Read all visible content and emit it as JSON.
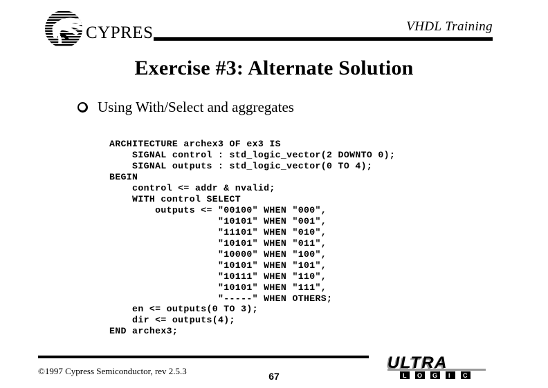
{
  "header": {
    "logo_name": "cypress-logo",
    "title": "VHDL Training"
  },
  "slide": {
    "title": "Exercise #3: Alternate Solution",
    "bullet": {
      "marker": "hollow-circle",
      "text": "Using With/Select and aggregates"
    },
    "code": "ARCHITECTURE archex3 OF ex3 IS\n    SIGNAL control : std_logic_vector(2 DOWNTO 0);\n    SIGNAL outputs : std_logic_vector(0 TO 4);\nBEGIN\n    control <= addr & nvalid;\n    WITH control SELECT\n        outputs <= \"00100\" WHEN \"000\",\n                   \"10101\" WHEN \"001\",\n                   \"11101\" WHEN \"010\",\n                   \"10101\" WHEN \"011\",\n                   \"10000\" WHEN \"100\",\n                   \"10101\" WHEN \"101\",\n                   \"10111\" WHEN \"110\",\n                   \"10101\" WHEN \"111\",\n                   \"-----\" WHEN OTHERS;\n    en <= outputs(0 TO 3);\n    dir <= outputs(4);\nEND archex3;",
    "code_lines": [
      "ARCHITECTURE archex3 OF ex3 IS",
      "    SIGNAL control : std_logic_vector(2 DOWNTO 0);",
      "    SIGNAL outputs : std_logic_vector(0 TO 4);",
      "BEGIN",
      "    control <= addr & nvalid;",
      "    WITH control SELECT",
      "        outputs <= \"00100\" WHEN \"000\",",
      "                   \"10101\" WHEN \"001\",",
      "                   \"11101\" WHEN \"010\",",
      "                   \"10101\" WHEN \"011\",",
      "                   \"10000\" WHEN \"100\",",
      "                   \"10101\" WHEN \"101\",",
      "                   \"10111\" WHEN \"110\",",
      "                   \"10101\" WHEN \"111\",",
      "                   \"-----\" WHEN OTHERS;",
      "    en <= outputs(0 TO 3);",
      "    dir <= outputs(4);",
      "END archex3;"
    ],
    "select_table": {
      "selector": "control",
      "target": "outputs",
      "entries": [
        {
          "value": "00100",
          "when": "000"
        },
        {
          "value": "10101",
          "when": "001"
        },
        {
          "value": "11101",
          "when": "010"
        },
        {
          "value": "10101",
          "when": "011"
        },
        {
          "value": "10000",
          "when": "100"
        },
        {
          "value": "10101",
          "when": "101"
        },
        {
          "value": "10111",
          "when": "110"
        },
        {
          "value": "10101",
          "when": "111"
        },
        {
          "value": "-----",
          "when": "OTHERS"
        }
      ]
    }
  },
  "footer": {
    "copyright": "©1997 Cypress Semiconductor, rev 2.5.3",
    "page_number": "67",
    "logo_primary": "ULTRA",
    "logo_secondary": [
      "L",
      "O",
      "G",
      "I",
      "C"
    ],
    "logo_name": "ultra-logic-logo"
  },
  "colors": {
    "background": "#ffffff",
    "foreground": "#000000",
    "logo_gray": "#9a9a9a"
  }
}
